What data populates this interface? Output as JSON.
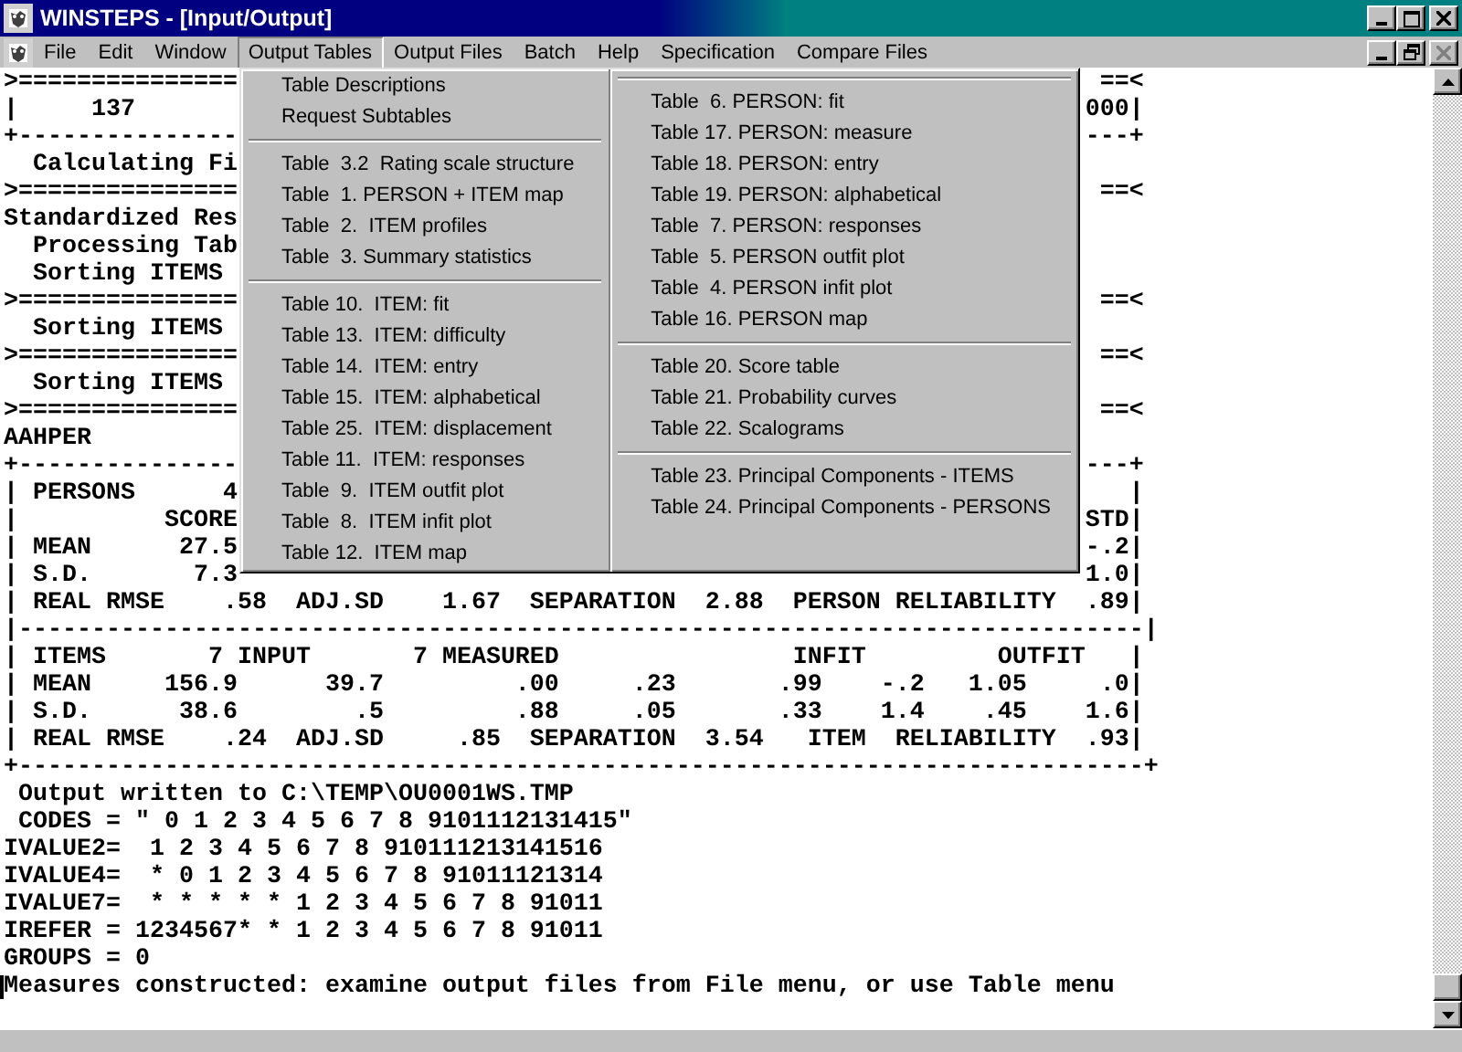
{
  "window": {
    "title": "WINSTEPS - [Input/Output]"
  },
  "menu_bar": [
    {
      "label": "File",
      "selected": false
    },
    {
      "label": "Edit",
      "selected": false
    },
    {
      "label": "Window",
      "selected": false
    },
    {
      "label": "Output Tables",
      "selected": true
    },
    {
      "label": "Output Files",
      "selected": false
    },
    {
      "label": "Batch",
      "selected": false
    },
    {
      "label": "Help",
      "selected": false
    },
    {
      "label": "Specification",
      "selected": false
    },
    {
      "label": "Compare Files",
      "selected": false
    }
  ],
  "child_window_controls": {
    "close_disabled": true
  },
  "output_tables_menu": {
    "columns": [
      [
        {
          "kind": "item",
          "label": "Table Descriptions"
        },
        {
          "kind": "item",
          "label": "Request Subtables"
        },
        {
          "kind": "separator"
        },
        {
          "kind": "item",
          "label": "Table  3.2  Rating scale structure"
        },
        {
          "kind": "item",
          "label": "Table  1. PERSON + ITEM map"
        },
        {
          "kind": "item",
          "label": "Table  2.  ITEM profiles"
        },
        {
          "kind": "item",
          "label": "Table  3. Summary statistics"
        },
        {
          "kind": "separator"
        },
        {
          "kind": "item",
          "label": "Table 10.  ITEM: fit"
        },
        {
          "kind": "item",
          "label": "Table 13.  ITEM: difficulty"
        },
        {
          "kind": "item",
          "label": "Table 14.  ITEM: entry"
        },
        {
          "kind": "item",
          "label": "Table 15.  ITEM: alphabetical"
        },
        {
          "kind": "item",
          "label": "Table 25.  ITEM: displacement"
        },
        {
          "kind": "item",
          "label": "Table 11.  ITEM: responses"
        },
        {
          "kind": "item",
          "label": "Table  9.  ITEM outfit plot"
        },
        {
          "kind": "item",
          "label": "Table  8.  ITEM infit plot"
        },
        {
          "kind": "item",
          "label": "Table 12.  ITEM map"
        }
      ],
      [
        {
          "kind": "separator"
        },
        {
          "kind": "item",
          "label": "Table  6. PERSON: fit"
        },
        {
          "kind": "item",
          "label": "Table 17. PERSON: measure"
        },
        {
          "kind": "item",
          "label": "Table 18. PERSON: entry"
        },
        {
          "kind": "item",
          "label": "Table 19. PERSON: alphabetical"
        },
        {
          "kind": "item",
          "label": "Table  7. PERSON: responses"
        },
        {
          "kind": "item",
          "label": "Table  5. PERSON outfit plot"
        },
        {
          "kind": "item",
          "label": "Table  4. PERSON infit plot"
        },
        {
          "kind": "item",
          "label": "Table 16. PERSON map"
        },
        {
          "kind": "separator"
        },
        {
          "kind": "item",
          "label": "Table 20. Score table"
        },
        {
          "kind": "item",
          "label": "Table 21. Probability curves"
        },
        {
          "kind": "item",
          "label": "Table 22. Scalograms"
        },
        {
          "kind": "separator"
        },
        {
          "kind": "item",
          "label": "Table 23. Principal Components - ITEMS"
        },
        {
          "kind": "item",
          "label": "Table 24. Principal Components - PERSONS"
        }
      ]
    ]
  },
  "console": {
    "lines": [
      {
        "left": ">===============",
        "right": "==<"
      },
      {
        "left": "|     137",
        "right": "000|"
      },
      {
        "left": "+---------------",
        "right": "---+"
      },
      {
        "left": "  Calculating Fi"
      },
      {
        "left": ">===============",
        "right": "==<"
      },
      {
        "left": "Standardized Res"
      },
      {
        "left": "  Processing Tab"
      },
      {
        "left": "  Sorting ITEMS"
      },
      {
        "left": ">===============",
        "right": "==<"
      },
      {
        "left": "  Sorting ITEMS"
      },
      {
        "left": ">===============",
        "right": "==<"
      },
      {
        "left": "  Sorting ITEMS"
      },
      {
        "left": ">===============",
        "right": "==<"
      },
      {
        "left": "AAHPER"
      },
      {
        "left": "+---------------",
        "right": "---+"
      },
      {
        "left": "| PERSONS      4",
        "right": "|"
      },
      {
        "left": "|          SCORE",
        "right": "STD|"
      },
      {
        "left": "| MEAN      27.5",
        "right": "-.2|"
      },
      {
        "left": "| S.D.       7.3",
        "right": "1.0|"
      },
      {
        "left": "| REAL RMSE    .58  ADJ.SD    1.67  SEPARATION  2.88  PERSON RELIABILITY  .89|"
      },
      {
        "left": "|-----------------------------------------------------------------------------|"
      },
      {
        "left": "| ITEMS       7 INPUT       7 MEASURED                INFIT         OUTFIT   |"
      },
      {
        "left": "| MEAN     156.9      39.7         .00     .23       .99    -.2   1.05     .0|"
      },
      {
        "left": "| S.D.      38.6        .5         .88     .05       .33    1.4    .45    1.6|"
      },
      {
        "left": "| REAL RMSE    .24  ADJ.SD     .85  SEPARATION  3.54   ITEM  RELIABILITY  .93|"
      },
      {
        "left": "+-----------------------------------------------------------------------------+"
      },
      {
        "left": " Output written to C:\\TEMP\\OU0001WS.TMP"
      },
      {
        "left": " CODES = \" 0 1 2 3 4 5 6 7 8 9101112131415\""
      },
      {
        "left": "IVALUE2=  1 2 3 4 5 6 7 8 910111213141516"
      },
      {
        "left": "IVALUE4=  * 0 1 2 3 4 5 6 7 8 91011121314"
      },
      {
        "left": "IVALUE7=  * * * * * 1 2 3 4 5 6 7 8 91011"
      },
      {
        "left": "IREFER = 1234567* * 1 2 3 4 5 6 7 8 91011"
      },
      {
        "left": "GROUPS = 0"
      },
      {
        "left": "Measures constructed: examine output files from File menu, or use Table menu",
        "cursor": true
      }
    ]
  }
}
